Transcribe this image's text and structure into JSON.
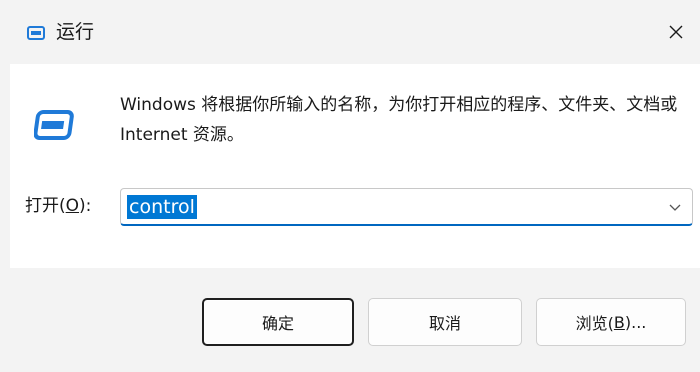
{
  "window": {
    "title": "运行",
    "close_glyph": "✕"
  },
  "dialog": {
    "description": "Windows 将根据你所输入的名称，为你打开相应的程序、文件夹、文档或 Internet 资源。",
    "open_label_prefix": "打开(",
    "open_label_accel": "O",
    "open_label_suffix": "):",
    "open_value": "control"
  },
  "buttons": {
    "ok": "确定",
    "cancel": "取消",
    "browse_prefix": "浏览(",
    "browse_accel": "B",
    "browse_suffix": ")..."
  },
  "icons": {
    "title": "run-icon",
    "main": "run-icon",
    "close": "close-icon",
    "dropdown": "chevron-down-icon"
  },
  "colors": {
    "accent": "#0078d4",
    "icon_blue": "#1f7ad8",
    "background": "#f3f3f3",
    "content": "#ffffff"
  }
}
